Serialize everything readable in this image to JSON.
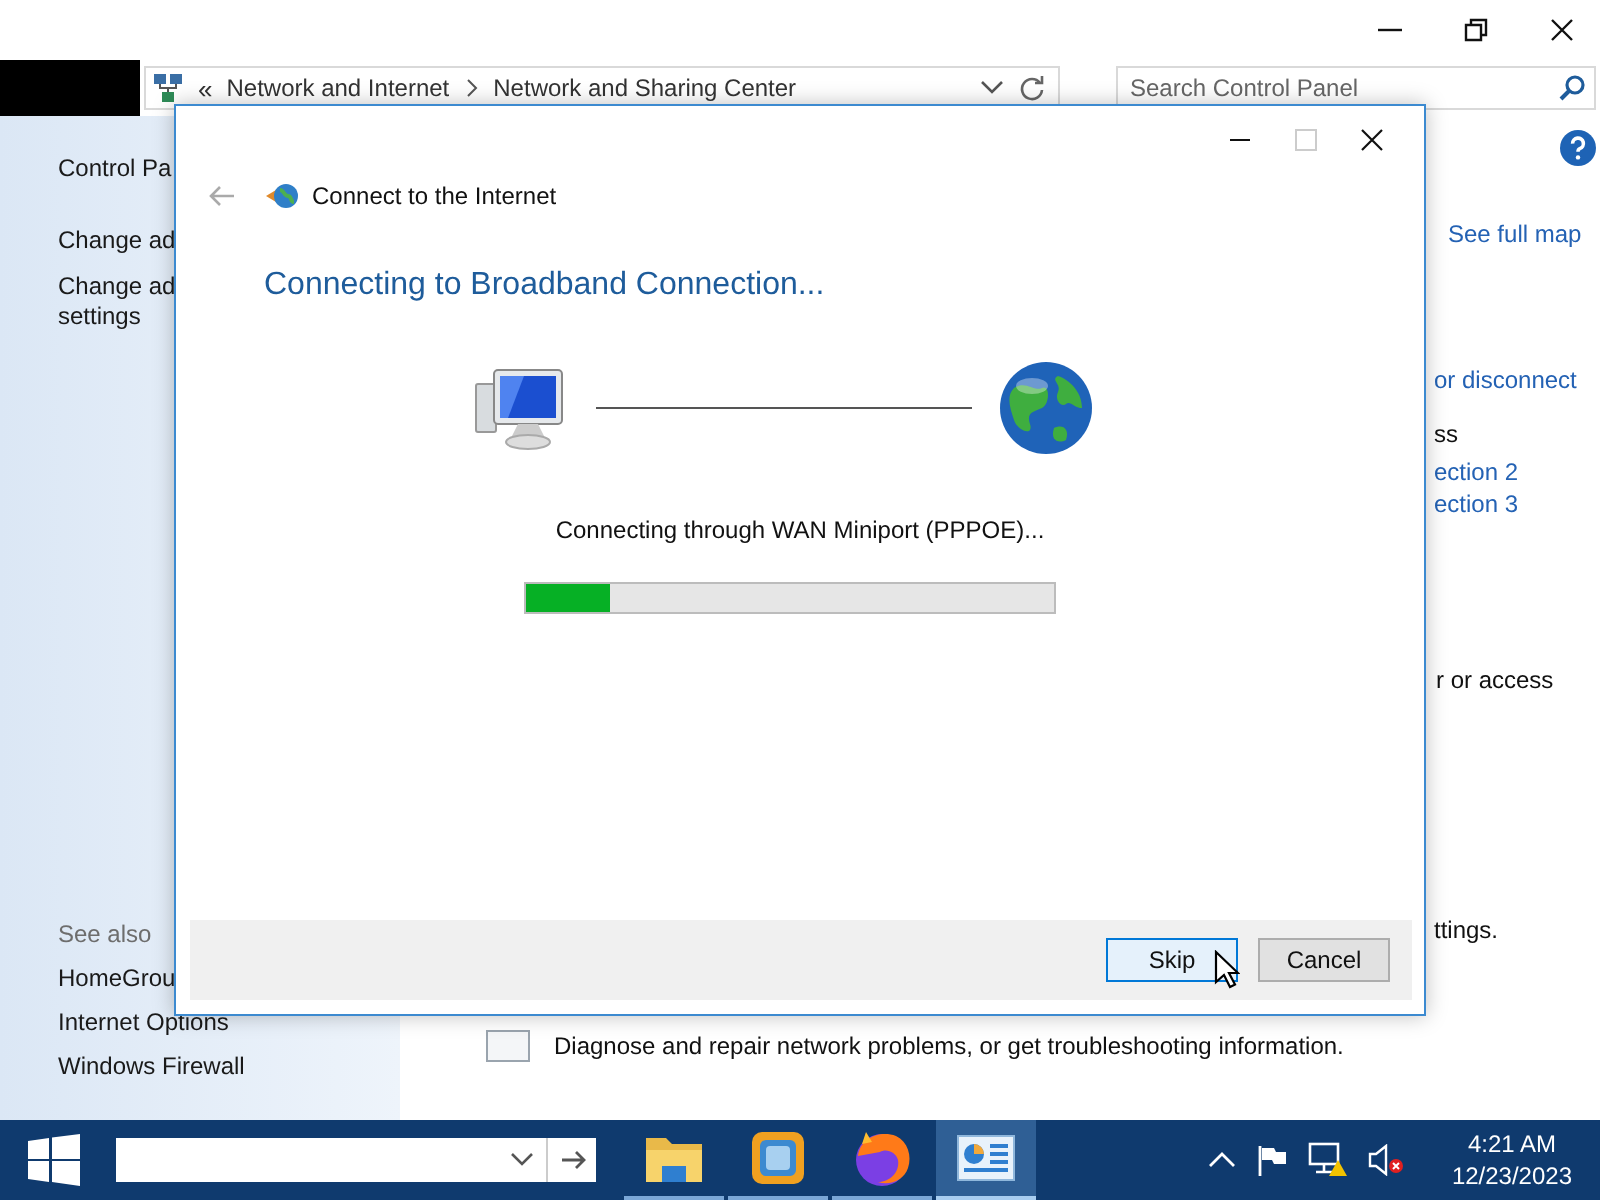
{
  "address_bar": {
    "prefix": "«",
    "crumbs": [
      "Network and Internet",
      "Network and Sharing Center"
    ]
  },
  "search": {
    "placeholder": "Search Control Panel"
  },
  "sidebar": {
    "items": [
      "Control Pa",
      "Change ad",
      "Change ad\nsettings"
    ],
    "see_also": {
      "heading": "See also",
      "items": [
        "HomeGrou",
        "Internet Options",
        "Windows Firewall"
      ]
    }
  },
  "main": {
    "fragments": [
      {
        "text": "See full map",
        "kind": "link"
      },
      {
        "text": "or disconnect",
        "kind": "link"
      },
      {
        "text": "ss",
        "kind": "plain"
      },
      {
        "text": "ection 2",
        "kind": "link"
      },
      {
        "text": "ection 3",
        "kind": "link"
      },
      {
        "text": "r or access",
        "kind": "plain"
      },
      {
        "text": "ttings.",
        "kind": "plain"
      }
    ],
    "task": "Diagnose and repair network problems, or get troubleshooting information."
  },
  "dialog": {
    "title": "Connect to the Internet",
    "heading": "Connecting to Broadband Connection...",
    "status": "Connecting through WAN Miniport (PPPOE)...",
    "progress": {
      "level": 0.16
    },
    "buttons": [
      {
        "label": "Skip",
        "focused": true
      },
      {
        "label": "Cancel",
        "focused": false
      }
    ]
  },
  "taskbar": {
    "apps": [
      {
        "kind": "folder",
        "selected": false
      },
      {
        "kind": "vm",
        "selected": false
      },
      {
        "kind": "browser",
        "selected": false
      },
      {
        "kind": "control-panel",
        "selected": true
      }
    ],
    "clock": {
      "time": "4:21 AM",
      "date": "12/23/2023"
    }
  }
}
